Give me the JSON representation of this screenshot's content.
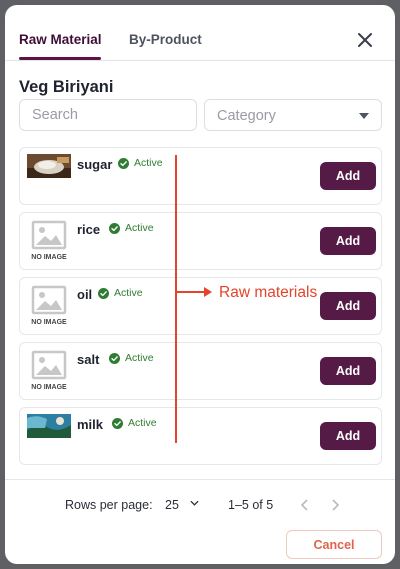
{
  "tabs": [
    {
      "label": "Raw Material",
      "active": true
    },
    {
      "label": "By-Product",
      "active": false
    }
  ],
  "recipe_title": "Veg Biriyani",
  "search": {
    "placeholder": "Search",
    "value": ""
  },
  "category": {
    "placeholder": "Category"
  },
  "items": [
    {
      "name": "sugar",
      "status": "Active",
      "image": "sugar-photo",
      "add_label": "Add"
    },
    {
      "name": "rice",
      "status": "Active",
      "image": "no-image",
      "image_label": "NO IMAGE",
      "add_label": "Add"
    },
    {
      "name": "oil",
      "status": "Active",
      "image": "no-image",
      "image_label": "NO IMAGE",
      "add_label": "Add"
    },
    {
      "name": "salt",
      "status": "Active",
      "image": "no-image",
      "image_label": "NO IMAGE",
      "add_label": "Add"
    },
    {
      "name": "milk",
      "status": "Active",
      "image": "milk-photo",
      "add_label": "Add"
    }
  ],
  "annotation": {
    "text": "Raw materials",
    "color": "#e4442b"
  },
  "pagination": {
    "rows_label": "Rows per page:",
    "rows_value": "25",
    "range": "1–5 of 5"
  },
  "footer": {
    "cancel_label": "Cancel"
  },
  "colors": {
    "primary": "#561a47",
    "active_status": "#2f7d32",
    "cancel": "#e2634a",
    "overlay": "#5f6064"
  }
}
